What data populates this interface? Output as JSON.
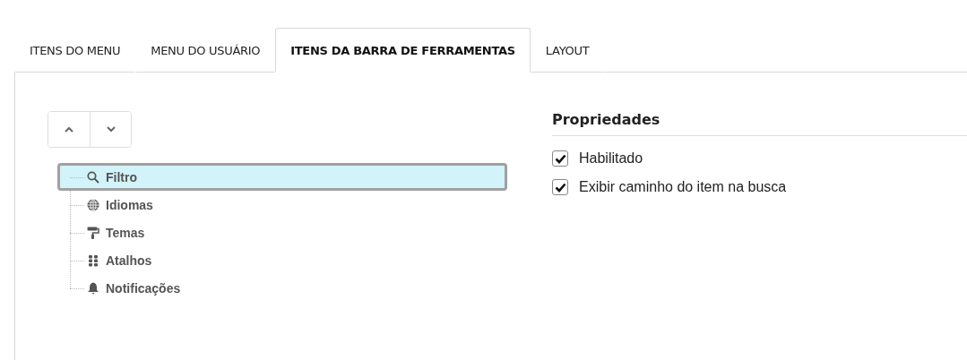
{
  "tabs": [
    {
      "label": "ITENS DO MENU",
      "selected": false
    },
    {
      "label": "MENU DO USUÁRIO",
      "selected": false
    },
    {
      "label": "ITENS DA BARRA DE FERRAMENTAS",
      "selected": true
    },
    {
      "label": "LAYOUT",
      "selected": false
    }
  ],
  "tree": [
    {
      "label": "Filtro",
      "selected": true
    },
    {
      "label": "Idiomas",
      "selected": false
    },
    {
      "label": "Temas",
      "selected": false
    },
    {
      "label": "Atalhos",
      "selected": false
    },
    {
      "label": "Notificações",
      "selected": false
    }
  ],
  "properties": {
    "title": "Propriedades",
    "options": [
      {
        "label": "Habilitado",
        "checked": true
      },
      {
        "label": "Exibir caminho do item na busca",
        "checked": true
      }
    ]
  }
}
